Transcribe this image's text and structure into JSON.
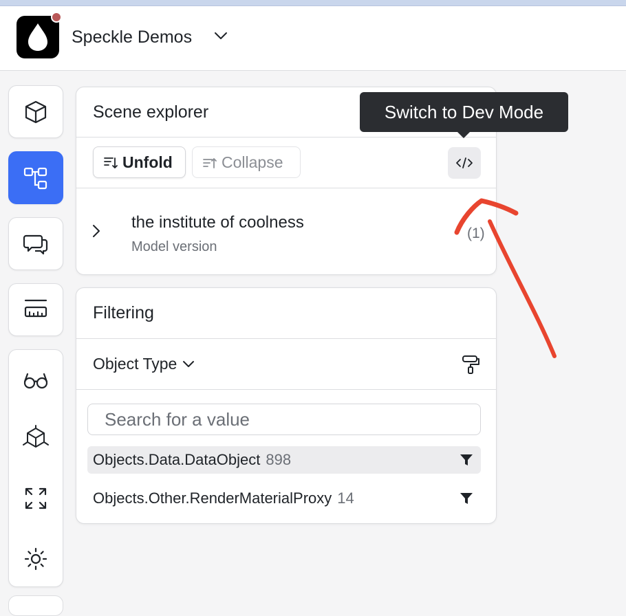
{
  "header": {
    "workspace_name": "Speckle Demos"
  },
  "rail": {
    "items": [
      "cube-icon",
      "scene-tree-icon",
      "comments-icon",
      "measure-icon"
    ],
    "active": "scene-tree-icon",
    "tools": [
      "glasses-icon",
      "section-box-icon",
      "fullscreen-icon",
      "sun-icon"
    ],
    "accent": "#3b6ef5"
  },
  "scene_explorer": {
    "title": "Scene explorer",
    "unfold_label": "Unfold",
    "collapse_label": "Collapse",
    "model_name": "the institute of coolness",
    "model_subtitle": "Model version",
    "model_count": "(1)"
  },
  "tooltip": {
    "text": "Switch to Dev Mode"
  },
  "filtering": {
    "title": "Filtering",
    "property_label": "Object Type",
    "search_placeholder": "Search for a value",
    "rows": [
      {
        "label": "Objects.Data.DataObject",
        "count": "898"
      },
      {
        "label": "Objects.Other.RenderMaterialProxy",
        "count": "14"
      }
    ]
  },
  "annotation": {
    "color": "#e8452f"
  }
}
